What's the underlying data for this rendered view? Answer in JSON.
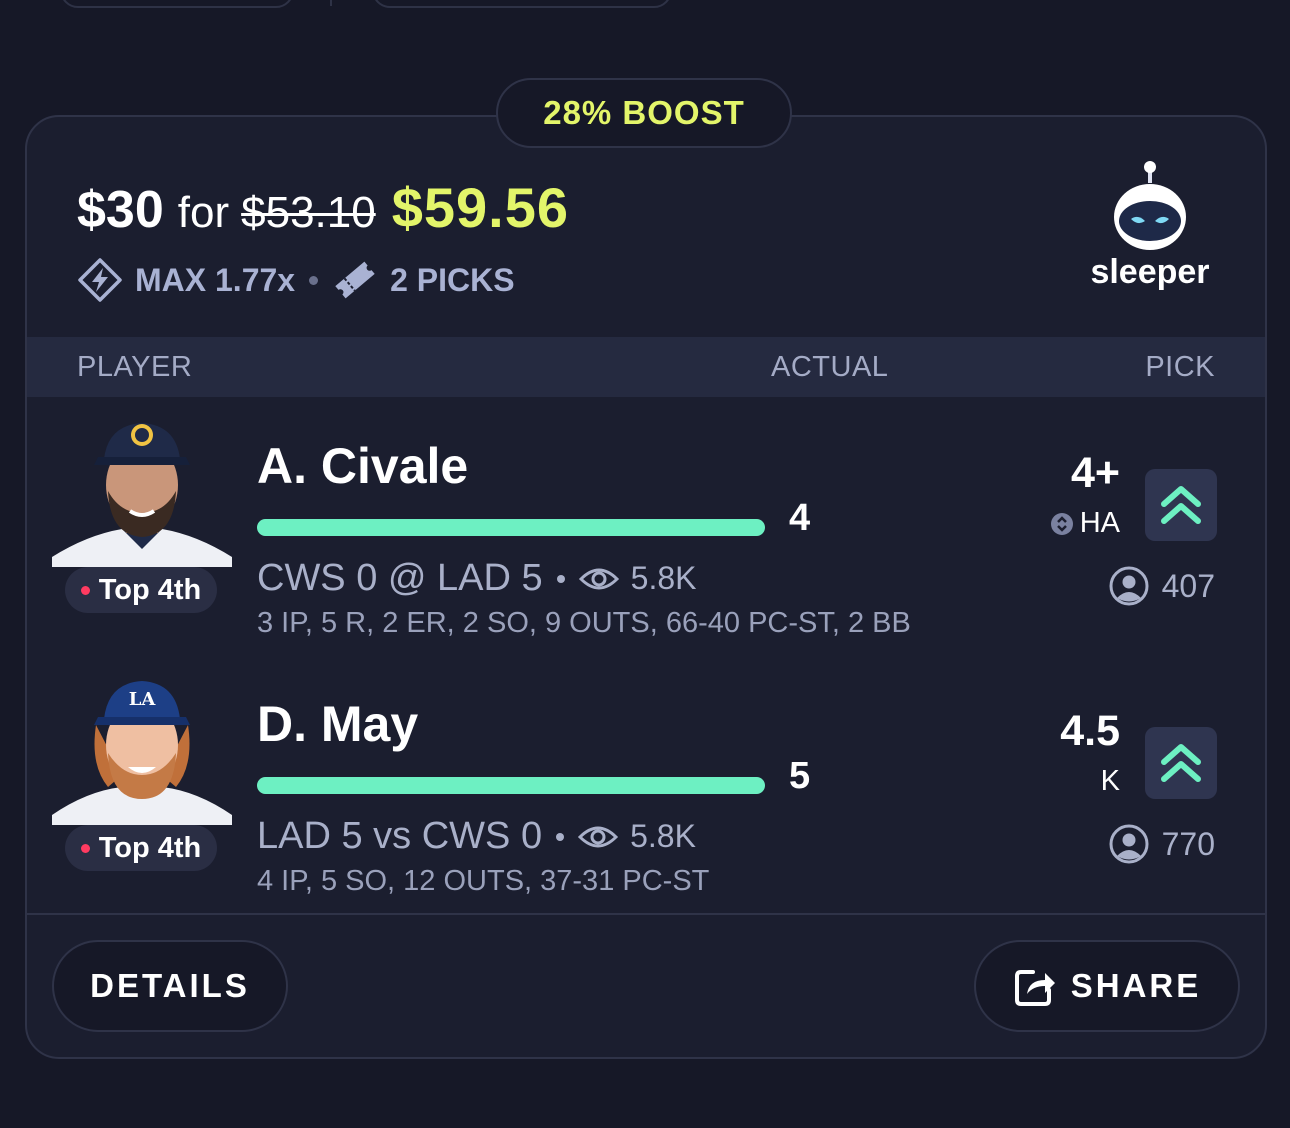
{
  "boost": {
    "label": "28% BOOST"
  },
  "summary": {
    "stake": "$30",
    "for_word": "for",
    "original_payout": "$53.10",
    "boosted_payout": "$59.56",
    "max_multiplier": "MAX 1.77x",
    "picks": "2 PICKS"
  },
  "brand": {
    "name": "sleeper",
    "icon": "sleeper-mascot-icon"
  },
  "table_header": {
    "player": "PLAYER",
    "actual": "ACTUAL",
    "pick": "PICK"
  },
  "players": [
    {
      "name": "A. Civale",
      "status": "Top 4th",
      "actual": "4",
      "progress": 1.0,
      "game": "CWS 0 @ LAD 5",
      "views": "5.8K",
      "stats": "3 IP, 5 R, 2 ER, 2 SO, 9 OUTS, 66-40 PC-ST, 2 BB",
      "line": "4+",
      "stat_type": "HA",
      "pick_direction": "higher",
      "pick_count": "407"
    },
    {
      "name": "D. May",
      "status": "Top 4th",
      "actual": "5",
      "progress": 1.0,
      "game": "LAD 5 vs CWS 0",
      "views": "5.8K",
      "stats": "4 IP, 5 SO, 12 OUTS, 37-31 PC-ST",
      "line": "4.5",
      "stat_type": "K",
      "pick_direction": "higher",
      "pick_count": "770"
    }
  ],
  "footer": {
    "details_label": "DETAILS",
    "share_label": "SHARE"
  },
  "colors": {
    "accent": "#e3f56a",
    "progress": "#6df0c2",
    "live": "#ff3b61",
    "background": "#161827",
    "card": "#1b1e2f"
  }
}
